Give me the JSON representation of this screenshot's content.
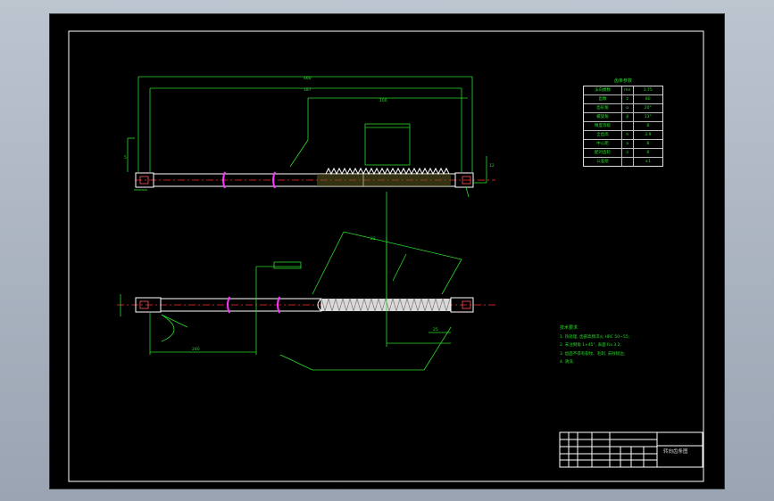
{
  "params_table": {
    "title": "齿条参数",
    "rows": [
      {
        "name": "法向模数",
        "sym": "mn",
        "val": "1.75"
      },
      {
        "name": "齿数",
        "sym": "z",
        "val": "80"
      },
      {
        "name": "齿形角",
        "sym": "α",
        "val": "20°"
      },
      {
        "name": "螺旋角",
        "sym": "β",
        "val": "13°"
      },
      {
        "name": "精度等级",
        "sym": "",
        "val": "8"
      },
      {
        "name": "全齿高",
        "sym": "h",
        "val": "3.9"
      },
      {
        "name": "中心距",
        "sym": "a",
        "val": "8"
      },
      {
        "name": "配对齿轮",
        "sym": "z",
        "val": "8"
      },
      {
        "name": "公差组",
        "sym": "",
        "val": "±1"
      }
    ]
  },
  "tech_req": {
    "title": "技术要求",
    "lines": [
      "1. 热处理, 齿部高频淬火 HRC 50~55;",
      "2. 未注倒角 1×45°, 表面 Ra 3.2;",
      "3. 齿面不得有裂纹、毛刺, 去除锐边;",
      "4. 清洗."
    ]
  },
  "title_block": {
    "drawing_name": "转向齿条图"
  },
  "dimensions": {
    "overall_length": "460",
    "thread_length": "187",
    "rack_length": "100",
    "dim_a": "12",
    "dim_b": "22",
    "dim_left": "5",
    "dim_bottom": "240",
    "dim_c": "25"
  },
  "colors": {
    "line": "#2bd92b",
    "part": "#ffffff",
    "center": "#ff2a2a",
    "section": "#ff33ff",
    "hatch": "#d4c86a"
  }
}
